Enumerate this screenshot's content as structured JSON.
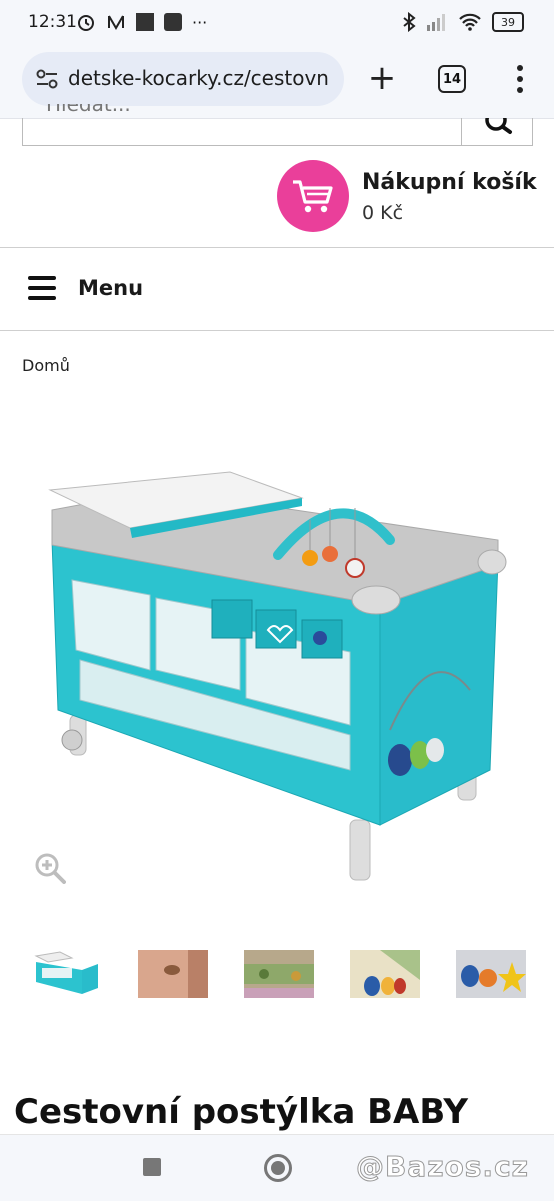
{
  "status_bar": {
    "time": "12:31",
    "battery": "39"
  },
  "browser": {
    "url": "detske-kocarky.cz/cestovn",
    "tab_count": "14"
  },
  "search": {
    "placeholder": "Hledat..."
  },
  "cart": {
    "title": "Nákupní košík",
    "price": "0 Kč",
    "accent_color": "#ea3f9a"
  },
  "menu": {
    "label": "Menu"
  },
  "breadcrumb": {
    "home": "Domů"
  },
  "product": {
    "title": "Cestovní postýlka BABY",
    "thumbnails": [
      "thumb-crib",
      "thumb-label",
      "thumb-pockets",
      "thumb-owls",
      "thumb-toys"
    ]
  },
  "watermark": "@Bazos.cz"
}
